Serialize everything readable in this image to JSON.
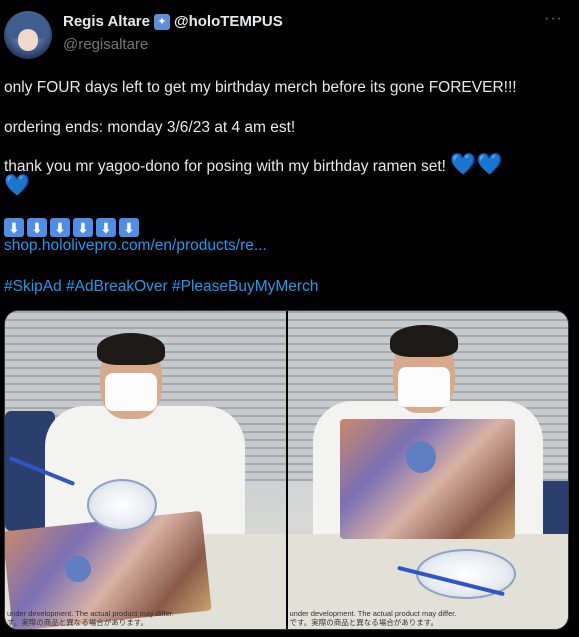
{
  "author": {
    "display_name": "Regis Altare",
    "badge_icon": "hololive-star-badge",
    "org_name": "@holoTEMPUS",
    "handle": "@regisaltare"
  },
  "menu": {
    "more_label": "···"
  },
  "tweet": {
    "line1": "only FOUR days left to get my birthday merch before its gone FOREVER!!!",
    "line2": "ordering ends: monday 3/6/23 at 4 am est!",
    "line3": "thank you mr yagoo-dono for posing with my birthday ramen set!",
    "hearts_emoji": "💙",
    "down_arrow_emoji": "⬇",
    "link_text": "shop.hololivepro.com/en/products/re...",
    "hashtags": "#SkipAd #AdBreakOver #PleaseBuyMyMerch"
  },
  "media": {
    "left_disclaimer_1": "under development. The actual product may differ.",
    "left_disclaimer_2": "す。実際の商品と異なる場合があります。",
    "right_disclaimer_1": "under development. The actual product may differ.",
    "right_disclaimer_2": "です。実際の商品と異なる場合があります。"
  },
  "colors": {
    "accent": "#1d9bf0",
    "background": "#000000",
    "muted": "#71767b"
  }
}
